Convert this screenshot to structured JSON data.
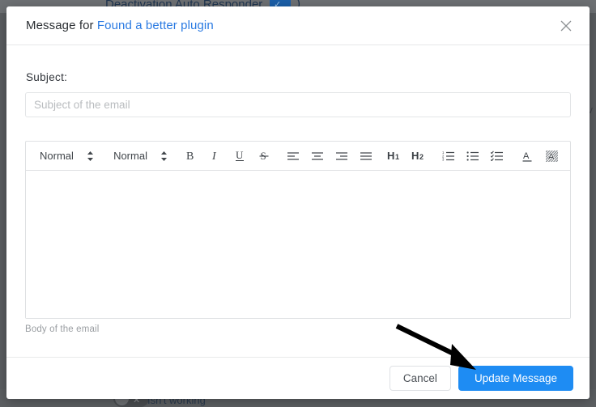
{
  "background": {
    "top_text": "Deactivation Auto Responder",
    "top_chip_icon": "check-icon",
    "top_paren": ")",
    "bottom_text": "Isn't working",
    "bottom_toggle_icon": "toggle-off-icon",
    "right_edge_mark": "v"
  },
  "modal": {
    "title_prefix": "Message for ",
    "title_link": "Found a better plugin",
    "close_icon": "close-icon",
    "subject": {
      "label": "Subject:",
      "value": "",
      "placeholder": "Subject of the email"
    },
    "editor": {
      "toolbar": {
        "block_format": {
          "value": "Normal",
          "caret_icon": "chevron-updown-icon"
        },
        "font_family": {
          "value": "Normal",
          "caret_icon": "chevron-updown-icon"
        },
        "buttons": [
          {
            "name": "bold-button",
            "icon": "bold-icon",
            "label": "B"
          },
          {
            "name": "italic-button",
            "icon": "italic-icon",
            "label": "I"
          },
          {
            "name": "underline-button",
            "icon": "underline-icon",
            "label": "U"
          },
          {
            "name": "strikethrough-button",
            "icon": "strikethrough-icon",
            "label": "S"
          },
          {
            "name": "align-left-button",
            "icon": "align-left-icon",
            "label": ""
          },
          {
            "name": "align-center-button",
            "icon": "align-center-icon",
            "label": ""
          },
          {
            "name": "align-right-button",
            "icon": "align-right-icon",
            "label": ""
          },
          {
            "name": "align-justify-button",
            "icon": "align-justify-icon",
            "label": ""
          },
          {
            "name": "heading-1-button",
            "icon": "h1-icon",
            "label": "H1"
          },
          {
            "name": "heading-2-button",
            "icon": "h2-icon",
            "label": "H2"
          },
          {
            "name": "ordered-list-button",
            "icon": "ordered-list-icon",
            "label": ""
          },
          {
            "name": "bullet-list-button",
            "icon": "bullet-list-icon",
            "label": ""
          },
          {
            "name": "check-list-button",
            "icon": "check-list-icon",
            "label": ""
          },
          {
            "name": "text-color-button",
            "icon": "text-color-icon",
            "label": "A"
          },
          {
            "name": "highlight-color-button",
            "icon": "highlight-color-icon",
            "label": "A"
          }
        ]
      },
      "content": "",
      "help_text": "Body of the email"
    },
    "footer": {
      "cancel_label": "Cancel",
      "submit_label": "Update Message"
    }
  },
  "annotation": {
    "arrow_icon": "arrow-pointer-icon",
    "arrow_color": "#000000",
    "points_to": "Update Message"
  },
  "colors": {
    "primary": "#1e8cf3",
    "link": "#2a7ae2",
    "border": "#dfe1e3",
    "placeholder": "#b9bcbf",
    "backdrop": "#5a5d60"
  }
}
